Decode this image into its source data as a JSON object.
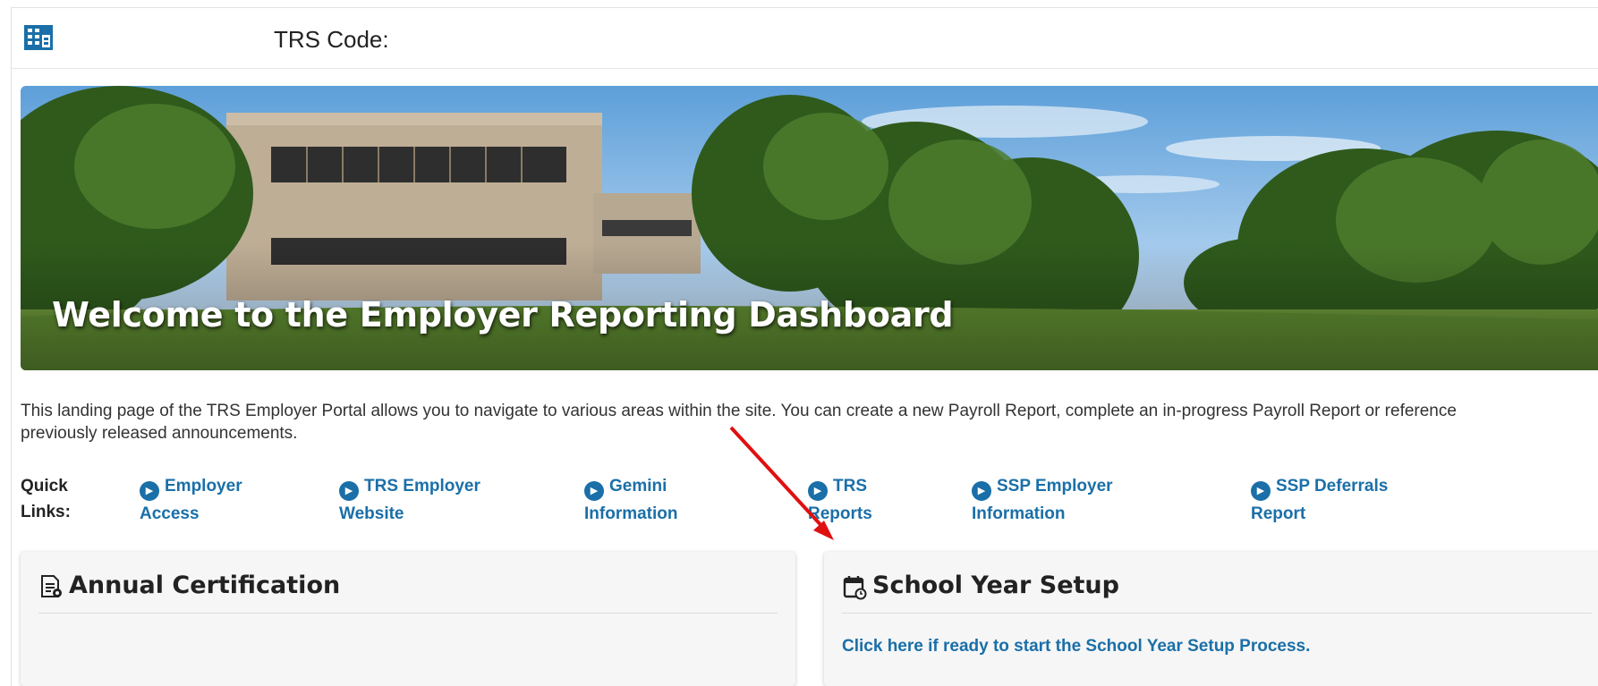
{
  "header": {
    "org_icon": "building-icon",
    "trs_code_label": "TRS Code:"
  },
  "hero": {
    "title": "Welcome to the Employer Reporting Dashboard"
  },
  "intro": {
    "text": "This landing page of the TRS Employer Portal allows you to navigate to various areas within the site. You can create a new Payroll Report, complete an in-progress Payroll Report or reference previously released announcements."
  },
  "quick_links": {
    "label_line1": "Quick",
    "label_line2": "Links:",
    "items": [
      {
        "line1": "Employer",
        "line2": "Access",
        "icon": "play-circle-icon"
      },
      {
        "line1": "TRS Employer",
        "line2": "Website",
        "icon": "play-circle-icon"
      },
      {
        "line1": "Gemini",
        "line2": "Information",
        "icon": "play-circle-icon"
      },
      {
        "line1": "TRS",
        "line2": "Reports",
        "icon": "play-circle-icon"
      },
      {
        "line1": "SSP Employer",
        "line2": "Information",
        "icon": "play-circle-icon"
      },
      {
        "line1": "SSP Deferrals",
        "line2": "Report",
        "icon": "play-circle-icon"
      }
    ]
  },
  "cards": {
    "annual": {
      "title": "Annual Certification",
      "icon": "certificate-document-icon"
    },
    "school_year": {
      "title": "School Year Setup",
      "icon": "calendar-clock-icon",
      "link_text": "Click here if ready to start the School Year Setup Process."
    }
  },
  "colors": {
    "link": "#1a6fa8",
    "annotation_arrow": "#e01010"
  }
}
